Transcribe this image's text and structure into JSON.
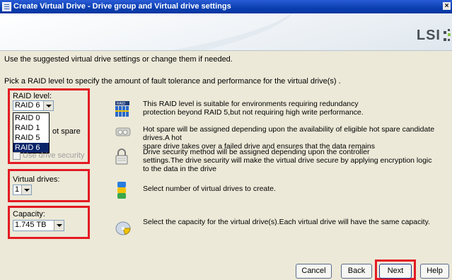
{
  "window": {
    "title": "Create Virtual Drive - Drive group and Virtual drive settings",
    "close_glyph": "×"
  },
  "brand": {
    "logo": "LSI"
  },
  "intro": "Use the suggested virtual drive settings or change them if needed.",
  "instruction": "Pick a RAID level to specify the amount of fault tolerance and performance for the virtual drive(s) .",
  "raid": {
    "label": "RAID level:",
    "selected": "RAID 6",
    "options": [
      "RAID 0",
      "RAID 1",
      "RAID 5",
      "RAID 6"
    ],
    "description_line1": "This RAID level is suitable for environments requiring redundancy",
    "description_line2": "protection beyond RAID 5,but not requiring high write performance."
  },
  "hot_spare": {
    "label_partial": "ot spare",
    "description_line1": "Hot spare will be assigned depending upon the availability of eligible hot spare candidate drives.A hot",
    "description_line2": "spare drive takes over a failed drive and ensures that the data remains"
  },
  "security": {
    "label": "Use drive security",
    "description_line1": "Drive security method will be assigned depending upon the controller",
    "description_line2": "settings.The drive security will make the virtual drive secure by applying encryption logic",
    "description_line3": "to the data in the drive"
  },
  "virtual_drives": {
    "label": "Virtual drives:",
    "value": "1",
    "description": "Select number of virtual drives to create."
  },
  "capacity": {
    "label": "Capacity:",
    "value": "1.745 TB",
    "description": "Select the capacity for the virtual drive(s).Each virtual drive will have the same capacity."
  },
  "buttons": {
    "cancel": "Cancel",
    "back": "Back",
    "next": "Next",
    "help": "Help"
  },
  "colors": {
    "highlight_box": "#e31b23",
    "title_bar": "#0a3fb0",
    "selection": "#0a246a",
    "background": "#ece9d8"
  },
  "icons": [
    "raid-array-icon",
    "hot-spare-drive-icon",
    "padlock-icon",
    "stacked-drives-icon",
    "capacity-disk-icon",
    "lsi-star-icon"
  ]
}
